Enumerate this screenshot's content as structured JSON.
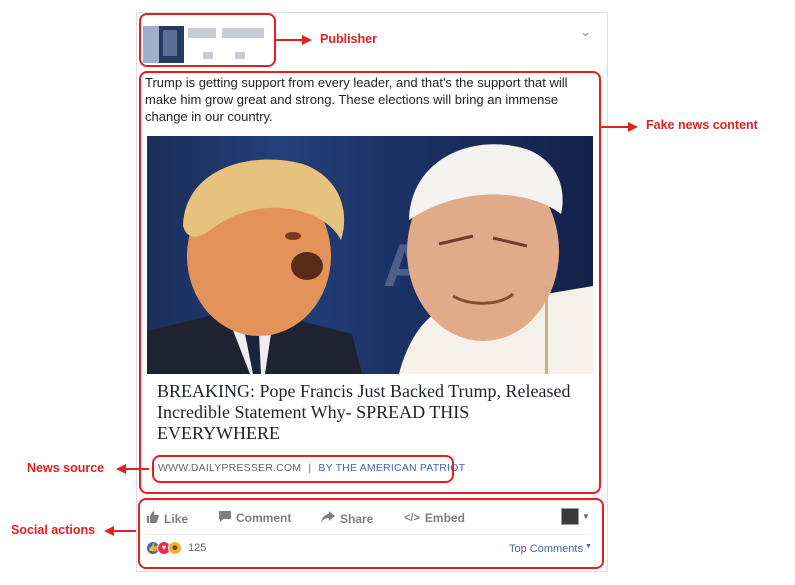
{
  "post": {
    "text": "Trump is getting support from every leader, and that's the support that will make him grow great and strong. These elections will bring an immense change in our country.",
    "headline": "BREAKING: Pope Francis Just Backed Trump, Released Incredible Statement Why- SPREAD THIS EVERYWHERE",
    "source_site": "WWW.DAILYPRESSER.COM",
    "source_separator": "|",
    "source_by": "BY THE AMERICAN PATRIOT"
  },
  "actions": {
    "like": "Like",
    "comment": "Comment",
    "share": "Share",
    "embed": "Embed"
  },
  "footer": {
    "reaction_count": "125",
    "top_comments": "Top Comments"
  },
  "annotations": {
    "publisher": "Publisher",
    "content": "Fake news content",
    "source": "News source",
    "social": "Social actions"
  },
  "colors": {
    "annotation": "#e32020",
    "link": "#4267b2",
    "text": "#1d2129"
  }
}
